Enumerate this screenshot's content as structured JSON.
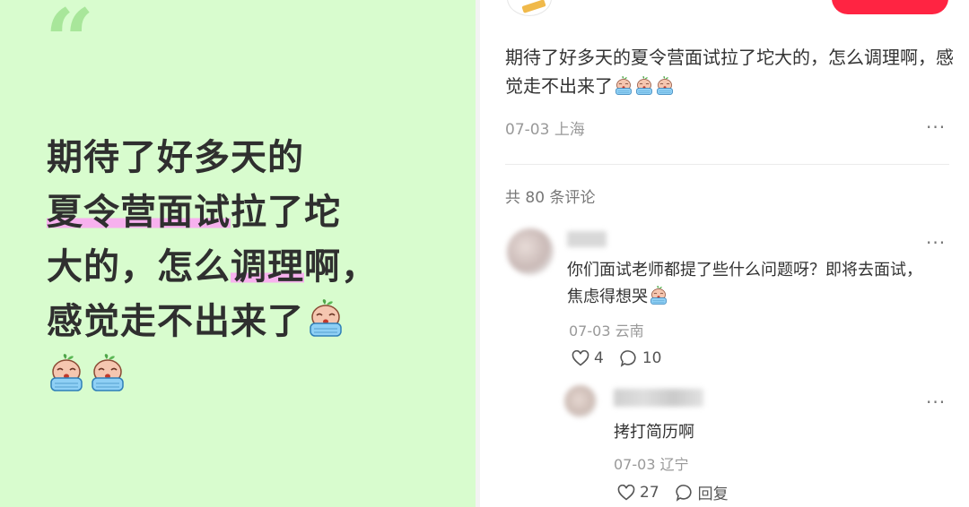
{
  "card": {
    "quote_mark": "“",
    "lines": [
      {
        "a": "期待了好多天的",
        "b": "",
        "c": ""
      },
      {
        "a": "",
        "b": "夏令营面试",
        "c": "拉了坨"
      },
      {
        "a": "大的，怎么",
        "b": "调理",
        "c": "啊，"
      },
      {
        "a": "感觉走不出来了",
        "b": "",
        "c": ""
      }
    ],
    "emoji_name": "crying-face-emoji"
  },
  "post": {
    "text": "期待了好多天的夏令营面试拉了坨大的，怎么调理啊，感觉走不出来了",
    "date": "07-03",
    "location": "上海",
    "more": "···"
  },
  "comments_header": {
    "label": "共 80 条评论"
  },
  "comment": {
    "text": "你们面试老师都提了些什么问题呀？即将去面试，焦虑得想哭",
    "date": "07-03",
    "location": "云南",
    "likes": "4",
    "replies": "10",
    "more": "···"
  },
  "reply": {
    "text": "拷打简历啊",
    "date": "07-03",
    "location": "辽宁",
    "likes": "27",
    "reply_label": "回复",
    "more": "···"
  },
  "colors": {
    "card_bg": "#d8fcce",
    "quote": "#a8e69a",
    "highlight": "#f7b1ee",
    "accent": "#ff2442"
  }
}
